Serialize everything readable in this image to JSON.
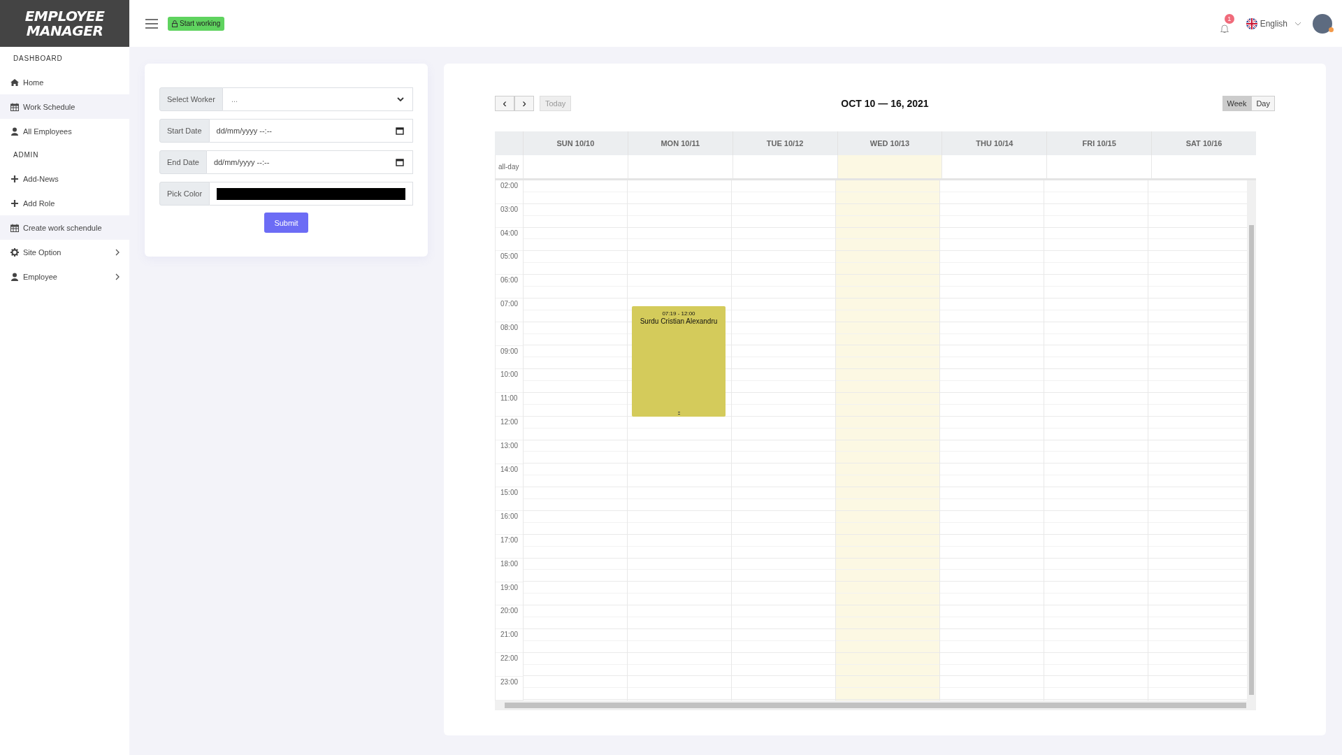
{
  "logo": {
    "line1": "EMPLOYEE",
    "line2": "MANAGER"
  },
  "header": {
    "start_button": "Start working",
    "notifications": "1",
    "language": "English"
  },
  "sidebar": {
    "items": [
      {
        "kind": "section",
        "label": "DASHBOARD"
      },
      {
        "kind": "link",
        "label": "Home",
        "selected": false,
        "expandable": false
      },
      {
        "kind": "link",
        "label": "Work Schedule",
        "selected": true,
        "expandable": false
      },
      {
        "kind": "link",
        "label": "All Employees",
        "selected": false,
        "expandable": false
      },
      {
        "kind": "section",
        "label": "ADMIN"
      },
      {
        "kind": "link",
        "label": "Add-News",
        "selected": false,
        "expandable": false
      },
      {
        "kind": "link",
        "label": "Add Role",
        "selected": false,
        "expandable": false
      },
      {
        "kind": "link",
        "label": "Create work schendule",
        "selected": true,
        "expandable": false
      },
      {
        "kind": "link",
        "label": "Site Option",
        "selected": false,
        "expandable": true
      },
      {
        "kind": "link",
        "label": "Employee",
        "selected": false,
        "expandable": true
      }
    ]
  },
  "form": {
    "fields": [
      {
        "kind": "select",
        "label": "Select Worker",
        "placeholder": "..."
      },
      {
        "kind": "datetime",
        "label": "Start Date",
        "value": "dd/mm/yyyy --:--"
      },
      {
        "kind": "datetime",
        "label": "End Date",
        "value": "dd/mm/yyyy --:--"
      },
      {
        "kind": "color",
        "label": "Pick Color",
        "color": "#000000"
      }
    ],
    "submit": "Submit"
  },
  "calendar": {
    "prev": "‹",
    "next": "›",
    "today_button": "Today",
    "title": "OCT 10 — 16, 2021",
    "views": [
      {
        "label": "Week",
        "selected": true
      },
      {
        "label": "Day",
        "selected": false
      }
    ],
    "allday_label": "all-day",
    "days": [
      {
        "label": "SUN 10/10",
        "today": false
      },
      {
        "label": "MON 10/11",
        "today": false,
        "events": [
          {
            "time": "07:19 - 12:00",
            "title": "Surdu Cristian Alexandru",
            "color": "#d4cb5b"
          }
        ]
      },
      {
        "label": "TUE 10/12",
        "today": false
      },
      {
        "label": "WED 10/13",
        "today": true
      },
      {
        "label": "THU 10/14",
        "today": false
      },
      {
        "label": "FRI 10/15",
        "today": false
      },
      {
        "label": "SAT 10/16",
        "today": false
      }
    ],
    "hours": [
      "02:00",
      "03:00",
      "04:00",
      "05:00",
      "06:00",
      "07:00",
      "08:00",
      "09:00",
      "10:00",
      "11:00",
      "12:00",
      "13:00",
      "14:00",
      "15:00",
      "16:00",
      "17:00",
      "18:00",
      "19:00",
      "20:00",
      "21:00",
      "22:00",
      "23:00"
    ]
  }
}
